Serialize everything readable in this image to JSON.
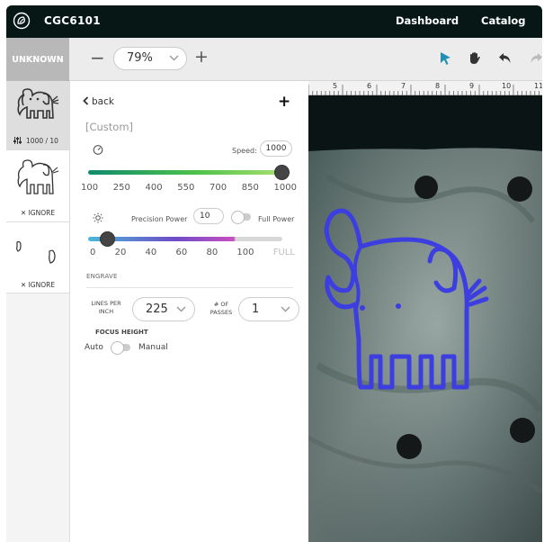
{
  "app": {
    "title": "CGC6101",
    "nav": {
      "dashboard": "Dashboard",
      "catalog": "Catalog"
    }
  },
  "toolbar": {
    "material_tab": "UNKNOWN",
    "zoom_out": "−",
    "zoom_value": "79%",
    "zoom_in": "+",
    "tools": [
      "select-arrow-icon",
      "pan-hand-icon",
      "undo-icon",
      "redo-icon"
    ],
    "active_tool_color": "#1f8fb3"
  },
  "thumbnails": [
    {
      "caption": "1000 / 10",
      "state": "selected",
      "icon": "elephant-engrave"
    },
    {
      "caption": "IGNORE",
      "state": "ignored",
      "icon": "elephant-outline"
    },
    {
      "caption": "IGNORE",
      "state": "ignored",
      "icon": "ear-shapes"
    }
  ],
  "panel": {
    "back": "back",
    "add": "+",
    "preset": "[Custom]",
    "speed": {
      "label": "Speed:",
      "value": "1000",
      "ticks": [
        "100",
        "250",
        "400",
        "550",
        "700",
        "850",
        "1000"
      ],
      "level": 1.0
    },
    "power": {
      "label": "Precision Power",
      "value": "10",
      "full_power_label": "Full Power",
      "full_power_on": false,
      "ticks": [
        "0",
        "20",
        "40",
        "60",
        "80",
        "100",
        "FULL"
      ],
      "level": 0.1
    },
    "engrave_label": "ENGRAVE",
    "lines_per_inch": {
      "label": "LINES PER INCH",
      "value": "225"
    },
    "passes": {
      "label": "# OF PASSES",
      "value": "1"
    },
    "focus": {
      "label": "FOCUS HEIGHT",
      "auto": "Auto",
      "manual": "Manual",
      "manual_on": false
    }
  },
  "canvas": {
    "ruler": [
      "5",
      "6",
      "7",
      "8",
      "9",
      "10",
      "11"
    ],
    "design_color": "#3c3ee0"
  }
}
